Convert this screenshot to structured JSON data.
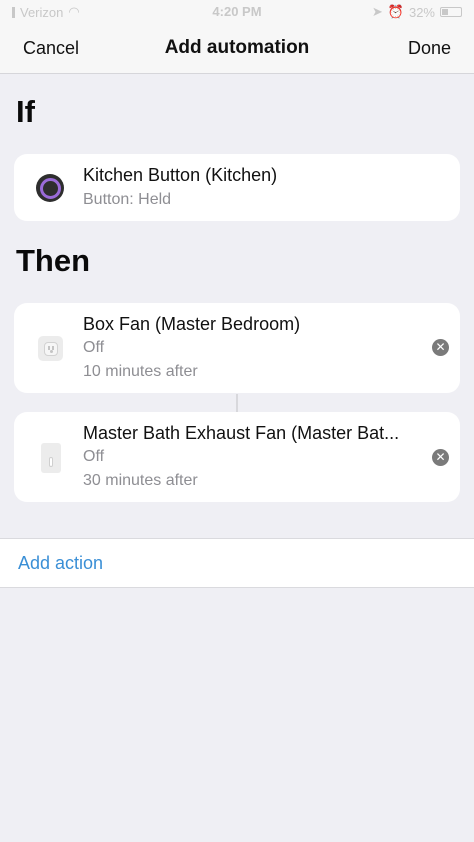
{
  "status_bar": {
    "carrier": "Verizon",
    "time": "4:20 PM",
    "battery": "32%"
  },
  "nav": {
    "cancel_label": "Cancel",
    "title": "Add automation",
    "done_label": "Done"
  },
  "if_section": {
    "heading": "If",
    "trigger": {
      "title": "Kitchen Button (Kitchen)",
      "subtitle": "Button: Held",
      "icon": "button-icon"
    }
  },
  "then_section": {
    "heading": "Then",
    "actions": [
      {
        "title": "Box Fan (Master Bedroom)",
        "state": "Off",
        "delay": "10 minutes after",
        "icon": "outlet-icon"
      },
      {
        "title": "Master Bath Exhaust Fan (Master Bat...",
        "state": "Off",
        "delay": "30 minutes after",
        "icon": "switch-icon"
      }
    ]
  },
  "add_action": {
    "label": "Add action"
  },
  "colors": {
    "accent": "#3a8fd6",
    "background": "#efeff4",
    "trigger_ring": "#9a6bd8"
  }
}
